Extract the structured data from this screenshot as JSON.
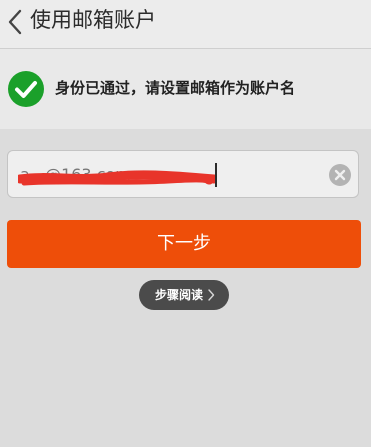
{
  "header": {
    "title": "使用邮箱账户",
    "back_icon": "chevron-left-icon"
  },
  "status": {
    "icon": "check-circle-icon",
    "icon_color": "#1ba02a",
    "message": "身份已通过，请设置邮箱作为账户名"
  },
  "email_input": {
    "value": "a...@163.com",
    "clear_icon": "clear-circle-icon"
  },
  "next_button": {
    "label": "下一步",
    "color": "#ee4e09"
  },
  "guide": {
    "label": "步骤阅读",
    "icon": "chevron-right-icon"
  },
  "colors": {
    "background": "#dcdcdc",
    "redaction": "#e8342a"
  }
}
